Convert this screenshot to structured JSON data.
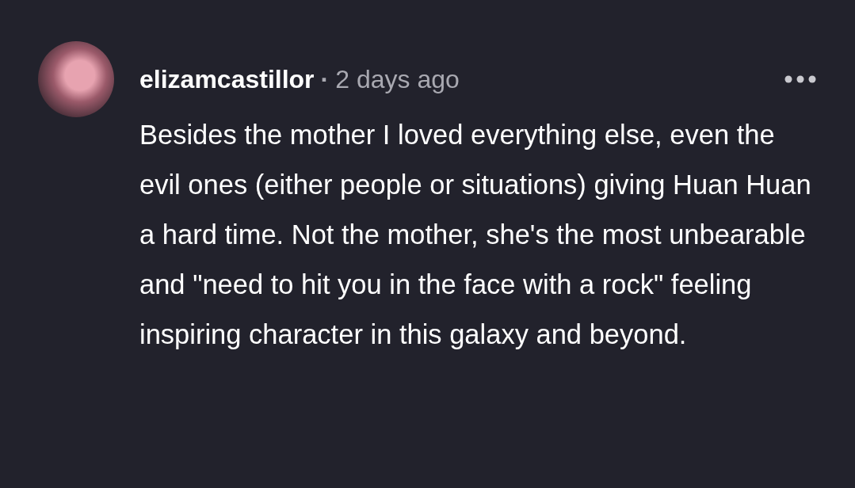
{
  "comment": {
    "author": "elizamcastillor",
    "separator": "·",
    "time": "2 days ago",
    "body": "Besides the mother I loved everything else, even the evil ones (either people or situations) giving Huan Huan a hard time. Not the mother, she's the most unbearable and \"need to hit you in the face with a rock\" feeling inspiring character in this galaxy and beyond."
  }
}
